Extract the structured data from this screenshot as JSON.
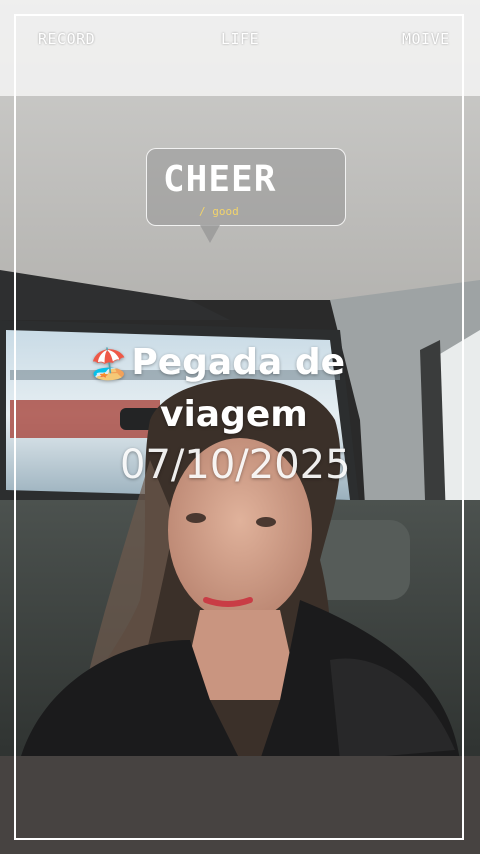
{
  "top_bar": {
    "left": "RECORD",
    "center": "LIFE",
    "right": "MOIVE"
  },
  "sticker": {
    "title": "CHEER",
    "subtitle": "/ good"
  },
  "caption": {
    "emoji": "🏖️",
    "line1": "Pegada de",
    "line2": "viagem",
    "date": "07/10/2025"
  },
  "colors": {
    "frame": "#ffffff",
    "sticker_sub": "#f2d36b"
  }
}
